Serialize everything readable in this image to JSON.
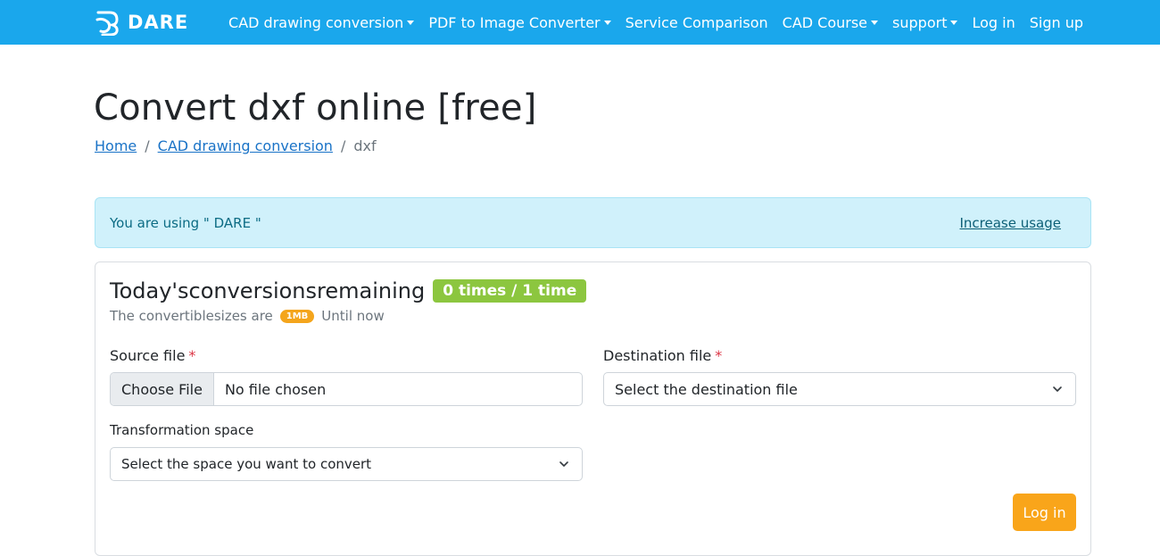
{
  "nav": {
    "brand": "DARE",
    "items": [
      {
        "label": "CAD drawing conversion",
        "dropdown": true
      },
      {
        "label": "PDF to Image Converter",
        "dropdown": true
      },
      {
        "label": "Service Comparison",
        "dropdown": false
      },
      {
        "label": "CAD Course",
        "dropdown": true
      },
      {
        "label": "support",
        "dropdown": true
      },
      {
        "label": "Log in",
        "dropdown": false
      },
      {
        "label": "Sign up",
        "dropdown": false
      }
    ],
    "bg_color": "#1aa7ec"
  },
  "page": {
    "title": "Convert dxf online [free]",
    "breadcrumb": [
      "Home",
      "CAD drawing conversion",
      "dxf"
    ]
  },
  "alert": {
    "message": "You are using \" DARE \"",
    "link": "Increase usage"
  },
  "card": {
    "heading": "Today'sconversionsremaining",
    "remaining_badge": "0 times / 1 time",
    "sizes_prefix": "The convertiblesizes are",
    "size_badge": "1MB",
    "sizes_suffix": "Until now",
    "source_label": "Source file",
    "required_mark": "*",
    "choose_file": "Choose File",
    "no_file": "No file chosen",
    "destination_label": "Destination file",
    "destination_select": "Select the destination file",
    "space_label": "Transformation space",
    "space_select": "Select the space you want to convert",
    "login_button": "Log in"
  },
  "colors": {
    "green_badge": "#8cc63f",
    "orange_badge": "#f4a51c",
    "login_button": "#f9a51a",
    "alert_bg": "#d0f1fb",
    "link": "#1a73c7"
  }
}
